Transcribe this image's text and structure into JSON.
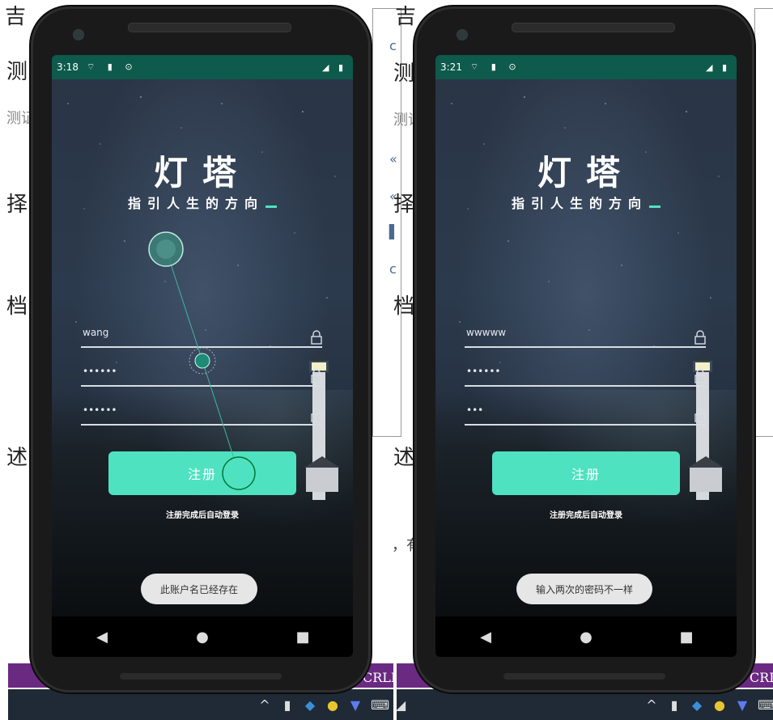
{
  "background_doc": {
    "left_column_chars": [
      "测",
      "测证",
      "择",
      "档",
      "述"
    ],
    "top_fragment": "吉",
    "middle_column_chars": [
      "测",
      "测证",
      "择",
      "档",
      "述"
    ],
    "comma_fragment": "，有",
    "crlf_left": "CRLF",
    "crlf_right": "CRLI"
  },
  "phones": [
    {
      "status_time": "3:18",
      "title_main": "灯塔",
      "title_sub": "指引人生的方向",
      "username_value": "wang",
      "password_value": "••••••",
      "confirm_value": "••••••",
      "register_label": "注册",
      "hint": "注册完成后自动登录",
      "toast": "此账户名已经存在"
    },
    {
      "status_time": "3:21",
      "title_main": "灯塔",
      "title_sub": "指引人生的方向",
      "username_value": "wwwww",
      "password_value": "••••••",
      "confirm_value": "•••",
      "register_label": "注册",
      "hint": "注册完成后自动登录",
      "toast": "输入两次的密码不一样"
    }
  ],
  "navbar": {
    "back": "◀",
    "home": "●",
    "recents": "■"
  },
  "colors": {
    "accent": "#4fe2c0",
    "statusbar": "#0e5a4c",
    "taskbar": "#1f2a36",
    "purple": "#6b2a82"
  },
  "icons": [
    "lock-icon",
    "wifi-icon",
    "signal-icon",
    "battery-icon"
  ]
}
